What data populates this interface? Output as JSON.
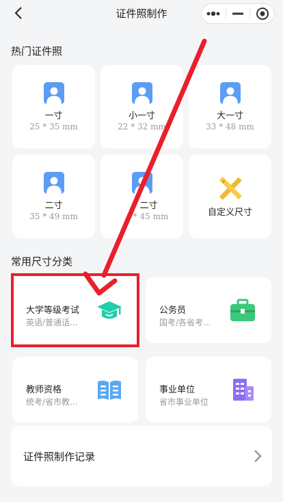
{
  "header": {
    "title": "证件照制作"
  },
  "hot_section": {
    "title": "热门证件照",
    "items": [
      {
        "name": "一寸",
        "size": "25 * 35 mm",
        "icon": "portrait-icon"
      },
      {
        "name": "小一寸",
        "size": "22 * 32 mm",
        "icon": "portrait-icon"
      },
      {
        "name": "大一寸",
        "size": "33 * 48 mm",
        "icon": "portrait-icon"
      },
      {
        "name": "二寸",
        "size": "35 * 49 mm",
        "icon": "portrait-icon"
      },
      {
        "name": "二寸",
        "size": "* 45 mm",
        "icon": "portrait-icon"
      },
      {
        "name": "自定义尺寸",
        "icon": "ruler-pencil-icon"
      }
    ]
  },
  "category_section": {
    "title": "常用尺寸分类",
    "items": [
      {
        "name": "大学等级考试",
        "sub": "英语/普通话...",
        "icon": "graduation-cap-icon",
        "color": "#1fcfa7"
      },
      {
        "name": "公务员",
        "sub": "国考/各省考...",
        "icon": "briefcase-icon",
        "color": "#3bc87a"
      },
      {
        "name": "教师资格",
        "sub": "统考/省市教...",
        "icon": "book-icon",
        "color": "#5aa8f0"
      },
      {
        "name": "事业单位",
        "sub": "省市事业单位",
        "icon": "building-icon",
        "color": "#8d6ef2"
      }
    ]
  },
  "record": {
    "label": "证件照制作记录"
  },
  "colors": {
    "accent_blue": "#5b9cf4",
    "highlight_red": "#ea1f2b"
  }
}
